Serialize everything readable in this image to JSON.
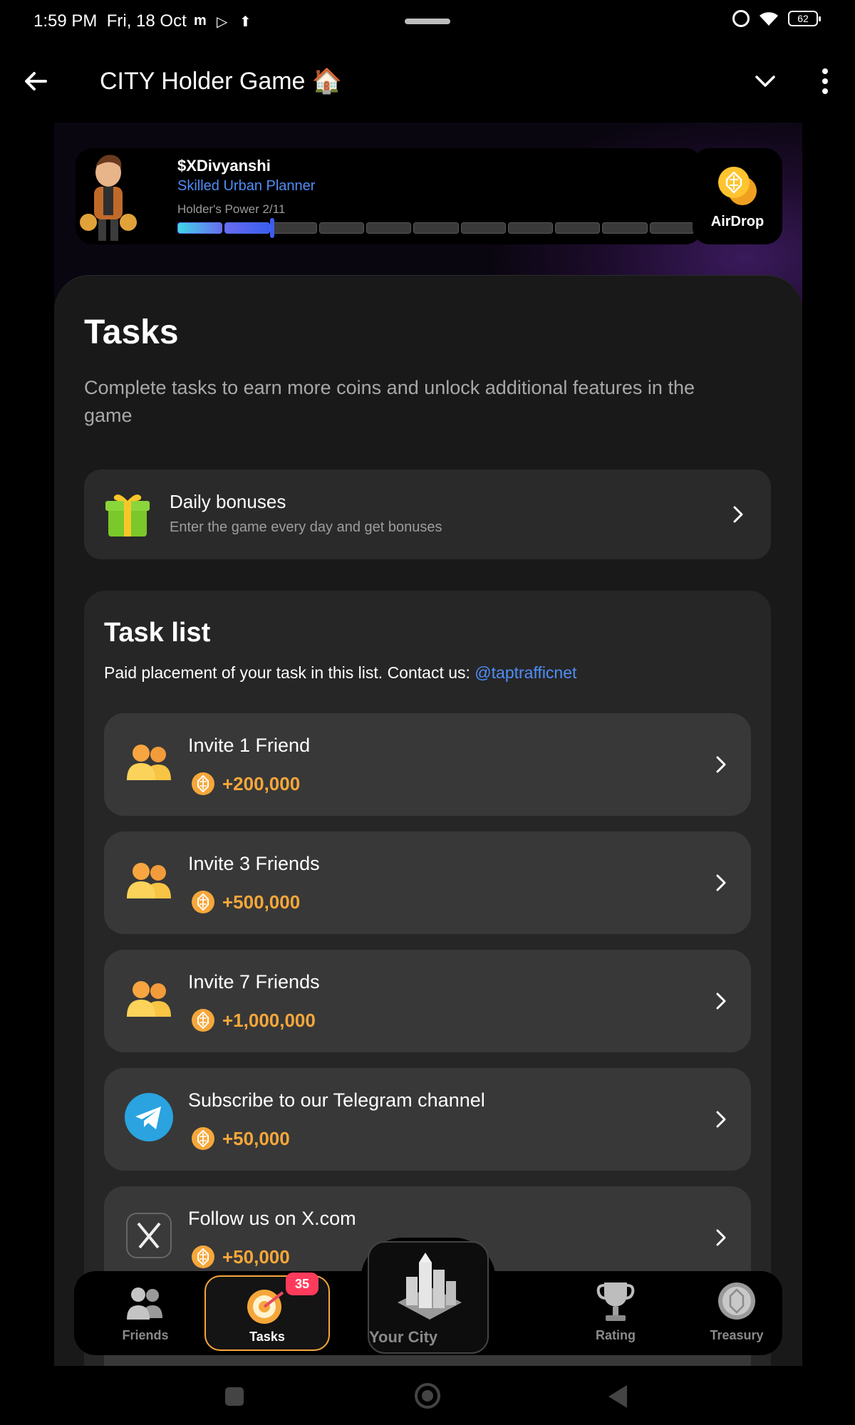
{
  "status_bar": {
    "time": "1:59 PM",
    "date": "Fri, 18 Oct",
    "app_icons": [
      "m",
      "▷",
      "⬆"
    ],
    "battery": "62"
  },
  "app_bar": {
    "title": "CITY Holder Game 🏠"
  },
  "profile": {
    "username": "$XDivyanshi",
    "rank": "Skilled Urban Planner",
    "power_label": "Holder's Power 2/11",
    "power_level": 2,
    "power_max": 11
  },
  "airdrop": {
    "label": "AirDrop"
  },
  "tasks_page": {
    "heading": "Tasks",
    "description": "Complete tasks to earn more coins and unlock additional features in the game"
  },
  "daily_bonus": {
    "title": "Daily bonuses",
    "subtitle": "Enter the game every day and get bonuses"
  },
  "task_list": {
    "title": "Task list",
    "note": "Paid placement of your task in this list. Contact us:",
    "contact": "@taptrafficnet",
    "items": [
      {
        "title": "Invite 1 Friend",
        "reward": "+200,000",
        "icon": "friends-icon"
      },
      {
        "title": "Invite 3 Friends",
        "reward": "+500,000",
        "icon": "friends-icon"
      },
      {
        "title": "Invite 7 Friends",
        "reward": "+1,000,000",
        "icon": "friends-icon"
      },
      {
        "title": "Subscribe to our Telegram channel",
        "reward": "+50,000",
        "icon": "telegram-icon"
      },
      {
        "title": "Follow us on X.com",
        "reward": "+50,000",
        "icon": "x-icon"
      }
    ]
  },
  "bottom_nav": {
    "friends": "Friends",
    "tasks": "Tasks",
    "tasks_badge": "35",
    "city": "Your City",
    "rating": "Rating",
    "treasury": "Treasury"
  },
  "colors": {
    "accent_orange": "#f6a73a",
    "link_blue": "#4f8ef7",
    "badge_red": "#ff3b5c"
  }
}
